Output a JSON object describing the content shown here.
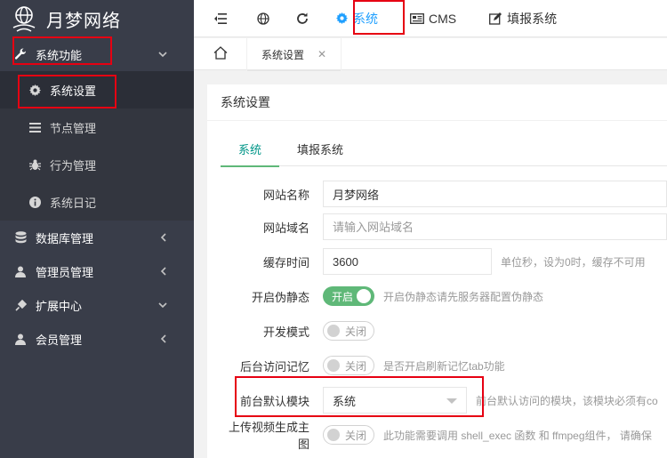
{
  "sidebar": {
    "logo_text": "月梦网络",
    "group_system": "系统功能",
    "sub_items": [
      {
        "label": "系统设置",
        "icon": "gear-icon"
      },
      {
        "label": "节点管理",
        "icon": "list-icon"
      },
      {
        "label": "行为管理",
        "icon": "bug-icon"
      },
      {
        "label": "系统日记",
        "icon": "info-icon"
      }
    ],
    "groups": [
      {
        "label": "数据库管理",
        "icon": "database-icon"
      },
      {
        "label": "管理员管理",
        "icon": "user-icon"
      },
      {
        "label": "扩展中心",
        "icon": "plugin-icon"
      },
      {
        "label": "会员管理",
        "icon": "user-icon"
      }
    ]
  },
  "topbar": {
    "links": [
      {
        "label": "系统",
        "icon": "gear-icon"
      },
      {
        "label": "CMS",
        "icon": "newspaper-icon"
      },
      {
        "label": "填报系统",
        "icon": "edit-icon"
      }
    ]
  },
  "tabs": {
    "page_tab": "系统设置"
  },
  "card": {
    "title": "系统设置",
    "tabs": [
      "系统",
      "填报系统"
    ]
  },
  "form": {
    "site_name_label": "网站名称",
    "site_name_value": "月梦网络",
    "site_domain_label": "网站域名",
    "site_domain_placeholder": "请输入网站域名",
    "cache_time_label": "缓存时间",
    "cache_time_value": "3600",
    "cache_time_hint": "单位秒，设为0时，缓存不可用",
    "pseudo_static_label": "开启伪静态",
    "pseudo_static_state": "开启",
    "pseudo_static_hint": "开启伪静态请先服务器配置伪静态",
    "dev_mode_label": "开发模式",
    "dev_mode_state": "关闭",
    "admin_record_label": "后台访问记忆",
    "admin_record_state": "关闭",
    "admin_record_hint": "是否开启刷新记忆tab功能",
    "default_module_label": "前台默认模块",
    "default_module_value": "系统",
    "default_module_hint": "前台默认访问的模块，该模块必须有co",
    "video_cover_label": "上传视频生成主图",
    "video_cover_state": "关闭",
    "video_cover_hint": "此功能需要调用 shell_exec 函数 和 ffmpeg组件， 请确保"
  },
  "colors": {
    "sidebar_bg": "#393d49",
    "accent_blue": "#1e9fff",
    "accent_green": "#5fb878",
    "tab_green": "#009688",
    "highlight_red": "#e60012"
  }
}
